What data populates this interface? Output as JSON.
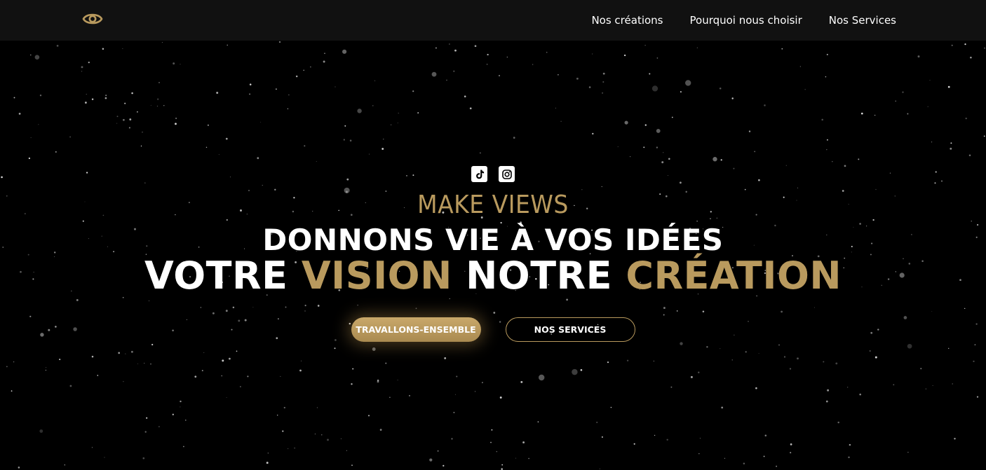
{
  "nav": {
    "logo_icon": "eye-icon",
    "links": [
      {
        "label": "Nos créations"
      },
      {
        "label": "Pourquoi nous choisir"
      },
      {
        "label": "Nos Services"
      }
    ]
  },
  "hero": {
    "socials": [
      {
        "icon": "tiktok-icon"
      },
      {
        "icon": "instagram-icon"
      }
    ],
    "brand": "MAKE VIEWS",
    "tagline": "DONNONS VIE À VOS IDÉES",
    "headline": {
      "part1": "VOTRE",
      "part2": "VISION",
      "part3": "NOTRE",
      "part4": "CRÉATION"
    },
    "cta_primary": "TRAVALLONS-ENSEMBLE",
    "cta_secondary": "NOS SERVICES"
  },
  "colors": {
    "accent_gold": "#b99a5e",
    "background": "#000000",
    "navbar": "#111111",
    "text": "#ffffff"
  }
}
